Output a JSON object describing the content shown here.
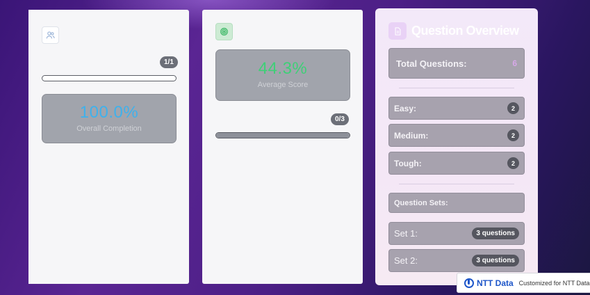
{
  "colors": {
    "completion_value": "#3fb1ec",
    "score_value": "#3fcf77",
    "brand_blue": "#1d56c9",
    "overview_title": "#ffffff"
  },
  "completion_card": {
    "icon": "users-icon",
    "count_badge": "1/1",
    "progress_fraction": 0.0,
    "value": "100.0%",
    "label": "Overall Completion"
  },
  "score_card": {
    "icon": "target-icon",
    "value": "44.3%",
    "label": "Average Score",
    "count_badge": "0/3",
    "progress_fraction": 1.0
  },
  "overview": {
    "icon": "document-icon",
    "title": "Question Overview",
    "total_label": "Total Questions:",
    "total_value": "6",
    "difficulty": [
      {
        "label": "Easy:",
        "count": "2"
      },
      {
        "label": "Medium:",
        "count": "2"
      },
      {
        "label": "Tough:",
        "count": "2"
      }
    ],
    "sets_header": "Question Sets:",
    "sets": [
      {
        "label": "Set 1:",
        "count": "3 questions"
      },
      {
        "label": "Set 2:",
        "count": "3 questions"
      }
    ]
  },
  "footer": {
    "brand": "NTT Data",
    "text": "Customized for NTT Data"
  }
}
